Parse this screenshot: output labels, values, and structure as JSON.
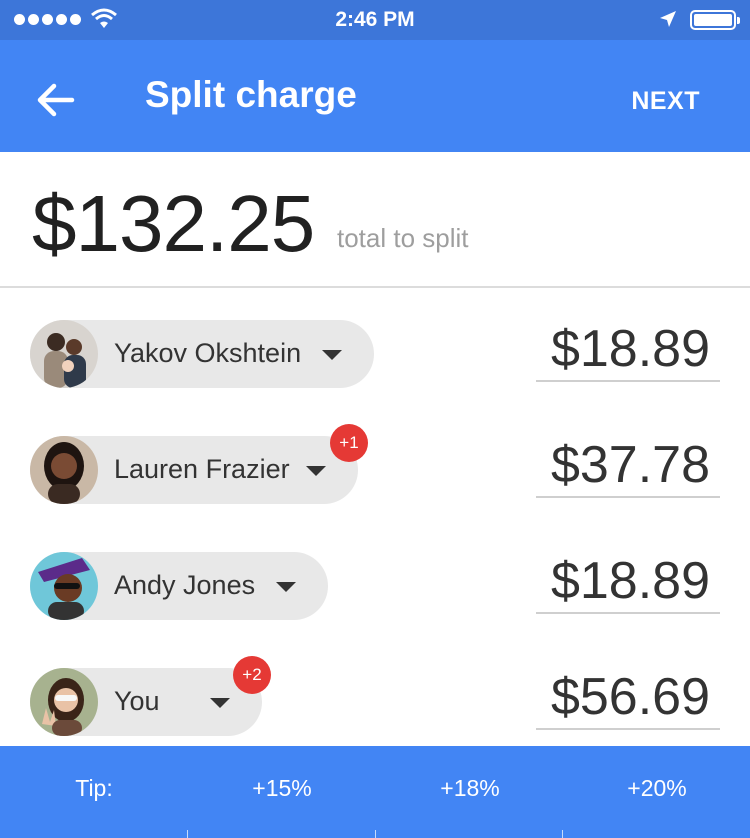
{
  "status_bar": {
    "time": "2:46 PM"
  },
  "app_bar": {
    "title": "Split charge",
    "action": "NEXT"
  },
  "total": {
    "amount": "$132.25",
    "label": "total to split"
  },
  "people": [
    {
      "name": "Yakov Okshtein",
      "amount": "$18.89",
      "badge": ""
    },
    {
      "name": "Lauren Frazier",
      "amount": "$37.78",
      "badge": "+1"
    },
    {
      "name": "Andy Jones",
      "amount": "$18.89",
      "badge": ""
    },
    {
      "name": "You",
      "amount": "$56.69",
      "badge": "+2"
    }
  ],
  "tip": {
    "label": "Tip:",
    "options": [
      "+15%",
      "+18%",
      "+20%"
    ]
  },
  "colors": {
    "primary": "#4285f4",
    "status_bar": "#3d76d9",
    "badge": "#e53935",
    "chip": "#e8e8e8"
  }
}
